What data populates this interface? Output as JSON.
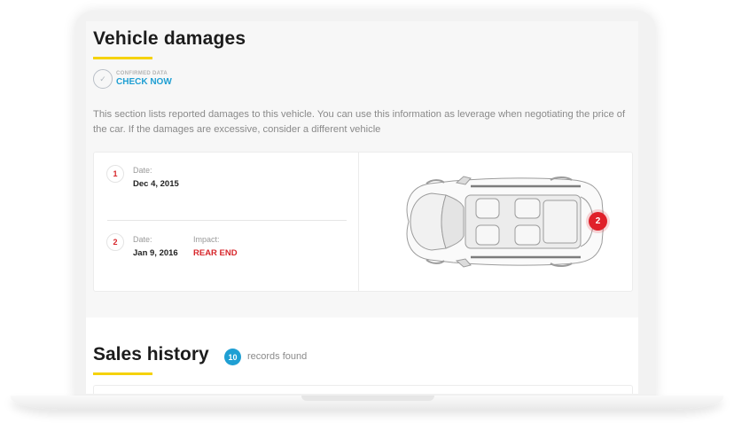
{
  "vehicle_damages": {
    "title": "Vehicle damages",
    "confirmed_label": "CONFIRMED DATA",
    "check_now_label": "CHECK NOW",
    "description": "This section lists reported damages to this vehicle. You can use this information as leverage when negotiating the price of the car. If the damages are excessive, consider a different vehicle",
    "records": [
      {
        "number": "1",
        "date_label": "Date:",
        "date": "Dec 4, 2015"
      },
      {
        "number": "2",
        "date_label": "Date:",
        "date": "Jan 9, 2016",
        "impact_label": "Impact:",
        "impact": "REAR END"
      }
    ],
    "diagram_marker": "2"
  },
  "sales_history": {
    "title": "Sales history",
    "count": "10",
    "count_label": "records found"
  },
  "colors": {
    "accent_yellow": "#f5d20a",
    "link_blue": "#1f9fd3",
    "damage_red": "#d7262b"
  },
  "icons": {
    "badge": "shield-check-icon",
    "car": "car-top-view-icon"
  }
}
